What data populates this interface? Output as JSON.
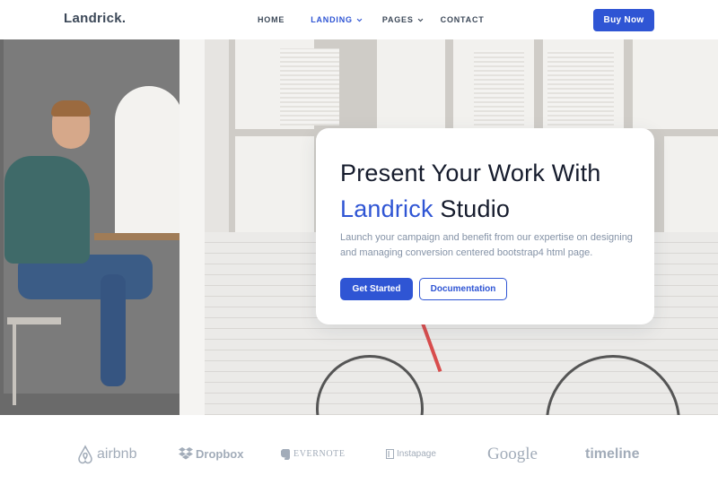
{
  "header": {
    "logo": "Landrick.",
    "nav": [
      {
        "label": "HOME",
        "dropdown": false,
        "active": false
      },
      {
        "label": "LANDING",
        "dropdown": true,
        "active": true
      },
      {
        "label": "PAGES",
        "dropdown": true,
        "active": false
      },
      {
        "label": "CONTACT",
        "dropdown": false,
        "active": false
      }
    ],
    "buy_label": "Buy Now"
  },
  "hero": {
    "title_line1": "Present Your Work With",
    "title_accent": "Landrick",
    "title_rest": " Studio",
    "description": "Launch your campaign and benefit from our expertise on designing and managing conversion centered bootstrap4 html page.",
    "primary_button": "Get Started",
    "secondary_button": "Documentation"
  },
  "partners": [
    {
      "name": "airbnb",
      "icon": "airbnb-icon"
    },
    {
      "name": "Dropbox",
      "icon": "dropbox-icon"
    },
    {
      "name": "EVERNOTE",
      "icon": "evernote-icon"
    },
    {
      "name": "Instapage",
      "icon": "instapage-icon"
    },
    {
      "name": "Google",
      "icon": ""
    },
    {
      "name": "timeline",
      "icon": ""
    }
  ],
  "colors": {
    "primary": "#2f55d4",
    "heading": "#161c2d",
    "muted": "#8492a6",
    "partner_gray": "#a2acb9"
  }
}
